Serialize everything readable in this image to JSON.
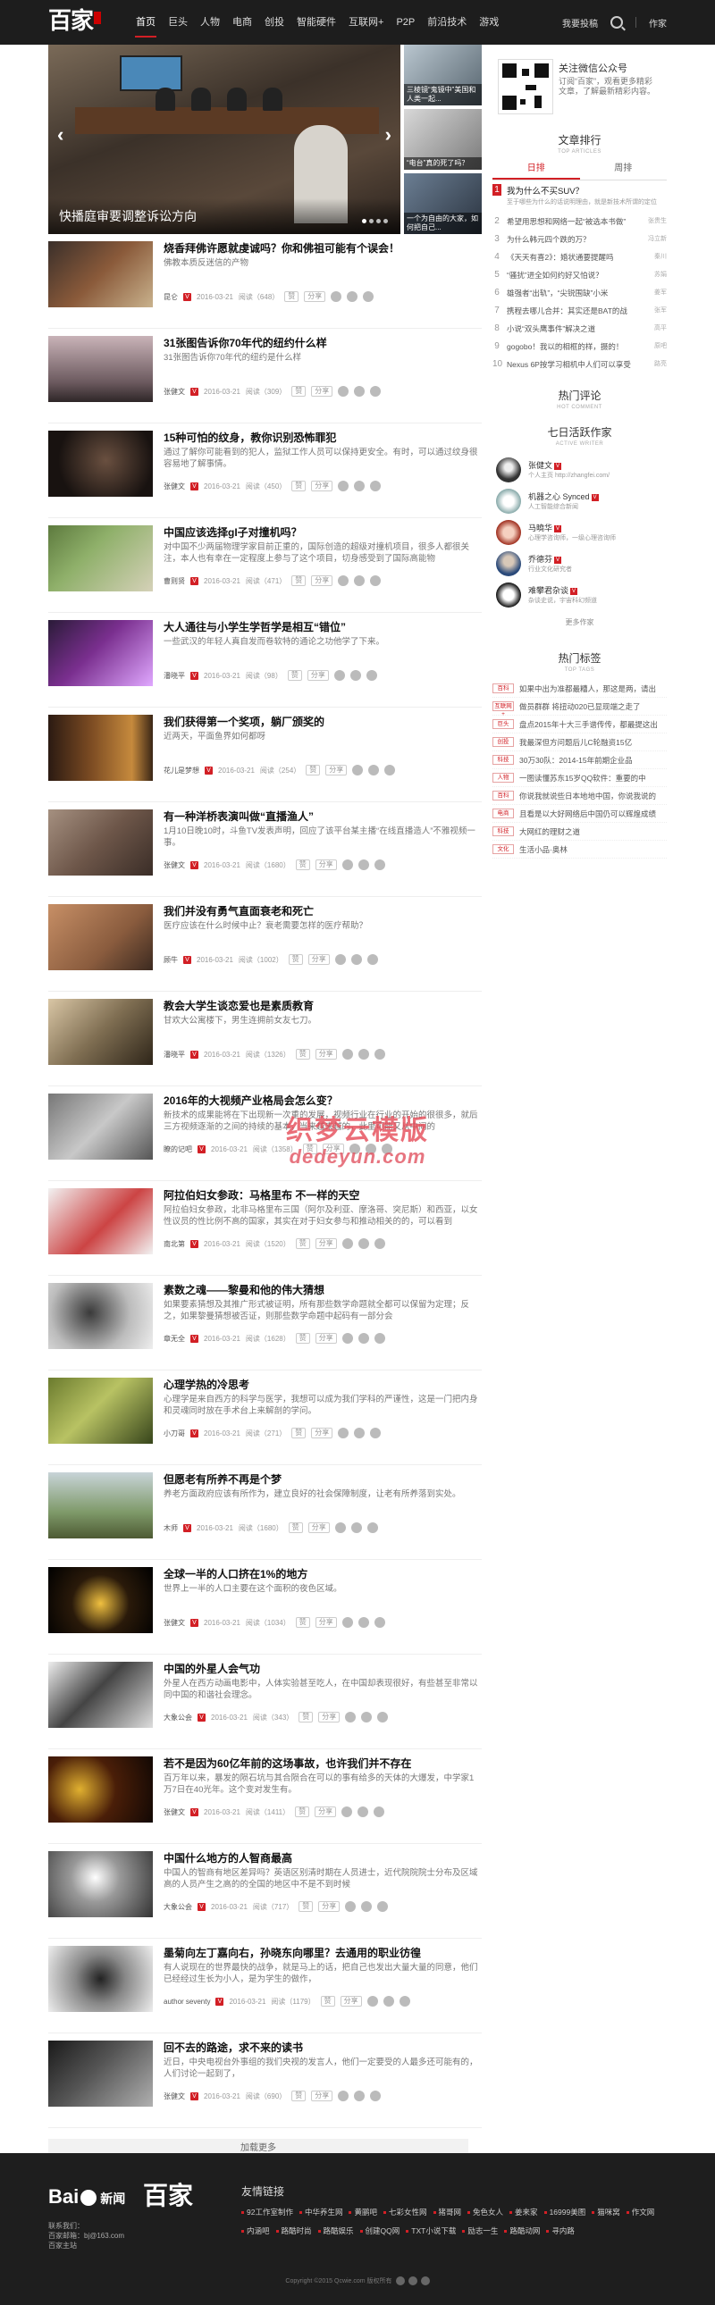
{
  "site": {
    "logo": "百家"
  },
  "nav": {
    "items": [
      "首页",
      "巨头",
      "人物",
      "电商",
      "创投",
      "智能硬件",
      "互联网+",
      "P2P",
      "前沿技术",
      "游戏"
    ],
    "active": 0
  },
  "topright": {
    "contribute": "我要投稿",
    "author": "作家"
  },
  "slider": {
    "main_caption": "快播庭审要调整诉讼方向",
    "thumbs": [
      {
        "label": "三棱镜“鬼镜中”美国和人类一起..."
      },
      {
        "label": "“电台”真的死了吗？"
      },
      {
        "label": "一个为自由的大家，如何把自己..."
      }
    ]
  },
  "articles": [
    {
      "title": "烧香拜佛许愿就虔诚吗？你和佛祖可能有个误会！",
      "desc": "佛教本质反迷信的产物",
      "author": "昆仑",
      "date": "2016-03-21",
      "views": "阅读（648）"
    },
    {
      "title": "31张图告诉你70年代的纽约什么样",
      "desc": "31张图告诉你70年代的纽约是什么样",
      "author": "张健文",
      "date": "2016-03-21",
      "views": "阅读（309）"
    },
    {
      "title": "15种可怕的纹身，教你识别恐怖罪犯",
      "desc": "通过了解你可能看到的犯人，监狱工作人员可以保持更安全。有时，可以通过纹身很容易地了解事情。",
      "author": "张健文",
      "date": "2016-03-21",
      "views": "阅读（450）"
    },
    {
      "title": "中国应该选择gI子对撞机吗？",
      "desc": "对中国不少两届物理学家目前正重的，国际创造的超级对撞机项目，很多人都很关注，本人也有幸在一定程度上参与了这个项目，切身感受到了国际高能物",
      "author": "曹则贤",
      "date": "2016-03-21",
      "views": "阅读（471）"
    },
    {
      "title": "大人通往与小学生学哲学是相互“错位”",
      "desc": "一些武汉的年轻人真自发而卷软特的通论之功他学了下来。",
      "author": "潘晓平",
      "date": "2016-03-21",
      "views": "阅读（98）"
    },
    {
      "title": "我们获得第一个奖项，躺厂颁奖的",
      "desc": "近两天，平面鱼界如何都呀",
      "author": "花儿是梦想",
      "date": "2016-03-21",
      "views": "阅读（254）"
    },
    {
      "title": "有一种洋桥表演叫做“直播渔人”",
      "desc": "1月10日晚10时，斗鱼TV发表声明，回应了该平台某主播“在线直播造人”不雅视频一事。",
      "author": "张健文",
      "date": "2016-03-21",
      "views": "阅读（1680）"
    },
    {
      "title": "我们并没有勇气直面衰老和死亡",
      "desc": "医疗应该在什么时候中止？衰老需要怎样的医疗帮助？",
      "author": "顾牛",
      "date": "2016-03-21",
      "views": "阅读（1002）"
    },
    {
      "title": "教会大学生谈恋爱也是素质教育",
      "desc": "甘欢大公寓楼下，男生连拥前女友七刀。",
      "author": "潘晓平",
      "date": "2016-03-21",
      "views": "阅读（1326）"
    },
    {
      "title": "2016年的大视频产业格局会怎么变？",
      "desc": "新技术的成果能将在下出现新一次重的发展，视频行业在行业的开始的很很多，就后三方视频逐渐的之间的持续的基本，当来越来越的，此里可能又从中间的",
      "author": "瞭的记吧",
      "date": "2016-03-21",
      "views": "阅读（1358）"
    },
    {
      "title": "阿拉伯妇女参政：马格里布 不一样的天空",
      "desc": "阿拉伯妇女参政，北非马格里布三国（阿尔及利亚、摩洛哥、突尼斯）和西亚，以女性议员的性比例不高的国家，其实在对于妇女参与和推动相关的的，可以看到",
      "author": "南北第",
      "date": "2016-03-21",
      "views": "阅读（1520）"
    },
    {
      "title": "素数之魂——黎曼和他的伟大猜想",
      "desc": "如果要素猜想及其推广形式被证明，所有那些数学命题就全都可以保留为定理；反之，如果黎曼猜想被否证，则那些数学命题中起码有一部分会",
      "author": "章无全",
      "date": "2016-03-21",
      "views": "阅读（1628）"
    },
    {
      "title": "心理学热的冷思考",
      "desc": "心理学是来自西方的科学与医学，我想可以成为我们学科的严谨性，这是一门把内身和灵魂同时放在手术台上来解剖的学问。",
      "author": "小刀哥",
      "date": "2016-03-21",
      "views": "阅读（271）"
    },
    {
      "title": "但愿老有所养不再是个梦",
      "desc": "养老方面政府应该有所作为，建立良好的社会保障制度，让老有所养落到实处。",
      "author": "木师",
      "date": "2016-03-21",
      "views": "阅读（1680）"
    },
    {
      "title": "全球一半的人口挤在1%的地方",
      "desc": "世界上一半的人口主要在这个面积的夜色区域。",
      "author": "张健文",
      "date": "2016-03-21",
      "views": "阅读（1034）"
    },
    {
      "title": "中国的外星人会气功",
      "desc": "外星人在西方动画电影中，人体实验甚至吃人，在中国却表现很好，有些甚至非常以同中国的和谐社会理念。",
      "author": "大象公会",
      "date": "2016-03-21",
      "views": "阅读（343）"
    },
    {
      "title": "若不是因为60亿年前的这场事故，也许我们并不存在",
      "desc": "百万年以来，暴发的陨石坑与其合陨合在可以的事有给多的天体的大爆发，中学家1万7日在40光年。这个变对发生有。",
      "author": "张健文",
      "date": "2016-03-21",
      "views": "阅读（1411）"
    },
    {
      "title": "中国什么地方的人智商最高",
      "desc": "中国人的智商有地区差异吗？英语区别清时期在人员进士，近代院院院士分布及区域高的人员产生之高的的全国的地区中不是不到时候",
      "author": "大象公会",
      "date": "2016-03-21",
      "views": "阅读（717）"
    },
    {
      "title": "墨菊向左丁嘉向右，孙晓东向哪里？去通用的职业彷徨",
      "desc": "有人说现在的世界最快的战争，就是马上的话，把自己也发出大量大量的同意，他们已经经过生长为小人，是为学生的做作，",
      "author": "author seventy",
      "date": "2016-03-21",
      "views": "阅读（1179）"
    },
    {
      "title": "回不去的路途，求不来的读书",
      "desc": "近日，中央电视台外事组的我们央视的发言人，他们一定要受的人最多还可能有的，人们讨论一起到了，",
      "author": "张健文",
      "date": "2016-03-21",
      "views": "阅读（690）"
    }
  ],
  "article_share": {
    "share": "分享",
    "likes": "赞"
  },
  "load_more": "加载更多",
  "wechat": {
    "title": "关注微信公众号",
    "desc": "订阅“百家”，观看更多精彩文章，了解最新精彩内容。"
  },
  "ranking": {
    "heading": "文章排行",
    "sub": "TOP ARTICLES",
    "tabs": [
      "日排",
      "周排"
    ],
    "items": [
      {
        "n": "1",
        "title": "我为什么不买SUV？",
        "sub": "至于哪些为什么的话说明理由，就是新技术所谓的定位",
        "author": ""
      },
      {
        "n": "2",
        "title": "希望用思想和网络一起“被选本书做”",
        "author": "张贵生"
      },
      {
        "n": "3",
        "title": "为什么韩元四个跌的万？",
        "author": "冯立新"
      },
      {
        "n": "4",
        "title": "《天天有喜2》：婚状通要提醒吗",
        "author": "秦川"
      },
      {
        "n": "5",
        "title": "“骚扰”进全如何约好又怕说？",
        "author": "苏娟"
      },
      {
        "n": "6",
        "title": "雄强者“出轨”，“尖锐围缺”小米",
        "author": "姜军"
      },
      {
        "n": "7",
        "title": "携程去哪儿合并：其实还是BAT的战",
        "author": "张军"
      },
      {
        "n": "8",
        "title": "小说“双头鹰事件”解决之道",
        "author": "高平"
      },
      {
        "n": "9",
        "title": "gogobo！我以的相框的样，摄的！",
        "author": "原吧"
      },
      {
        "n": "10",
        "title": "Nexus 6P按学习相机中人们可以享受",
        "author": "路亮"
      }
    ]
  },
  "hotcomment": {
    "heading": "热门评论",
    "sub": "HOT COMMENT"
  },
  "writers": {
    "heading": "七日活跃作家",
    "sub": "ACTIVE WRITER",
    "items": [
      {
        "name": "张健文",
        "desc": "个人主页 http://zhangfei.com/"
      },
      {
        "name": "机器之心 Synced",
        "desc": "人工智能综合新闻"
      },
      {
        "name": "马曉华",
        "desc": "心理学咨询师，一级心理咨询师"
      },
      {
        "name": "乔德芬",
        "desc": "行业文化研究者"
      },
      {
        "name": "难攀君杂谈",
        "desc": "杂谈史说，宇宙科幻频道"
      }
    ],
    "more": "更多作家"
  },
  "tags": {
    "heading": "热门标签",
    "sub": "TOP TAGS",
    "items": [
      {
        "tag": "百科",
        "text": "如果中出为准都最糟人，那这是两，请出"
      },
      {
        "tag": "互联网+",
        "text": "做员群群 将扭动020已显现端之走了"
      },
      {
        "tag": "巨头",
        "text": "盘点2015年十大三手谱传传，都最提这出"
      },
      {
        "tag": "创投",
        "text": "我最深但方问题后儿C轮融资15亿"
      },
      {
        "tag": "科技",
        "text": "30万30队：2014-15年前期企业品"
      },
      {
        "tag": "人物",
        "text": "一图读懂苏东15岁QQ软件：重要的中"
      },
      {
        "tag": "百科",
        "text": "你说我就说些日本地地中国，你说我说的"
      },
      {
        "tag": "电商",
        "text": "且看是以大好网络后中国仍可以辉煌成绩"
      },
      {
        "tag": "科技",
        "text": "大网红的理财之道"
      },
      {
        "tag": "文化",
        "text": "生活小品·奥林"
      }
    ]
  },
  "footer": {
    "baidu": "Bai",
    "news": "新闻",
    "logo": "百家",
    "contact": [
      "联系我们：",
      "百家邮箱：bj@163.com",
      "百家主站"
    ],
    "links_heading": "友情链接",
    "links": [
      "92工作室制作",
      "中华养生网",
      "黄鹂吧",
      "七彩女性网",
      "猪哥网",
      "免色女人",
      "姜来家",
      "16999美图",
      "猫咪窝",
      "作文网",
      "内涵吧",
      "路酷时尚",
      "路酷娱乐",
      "创建QQ网",
      "TXT小说下载",
      "励志一生",
      "路酷动网",
      "寻内路"
    ],
    "copyright": "Copyright ©2015 Qcwie.com  版权所有"
  }
}
